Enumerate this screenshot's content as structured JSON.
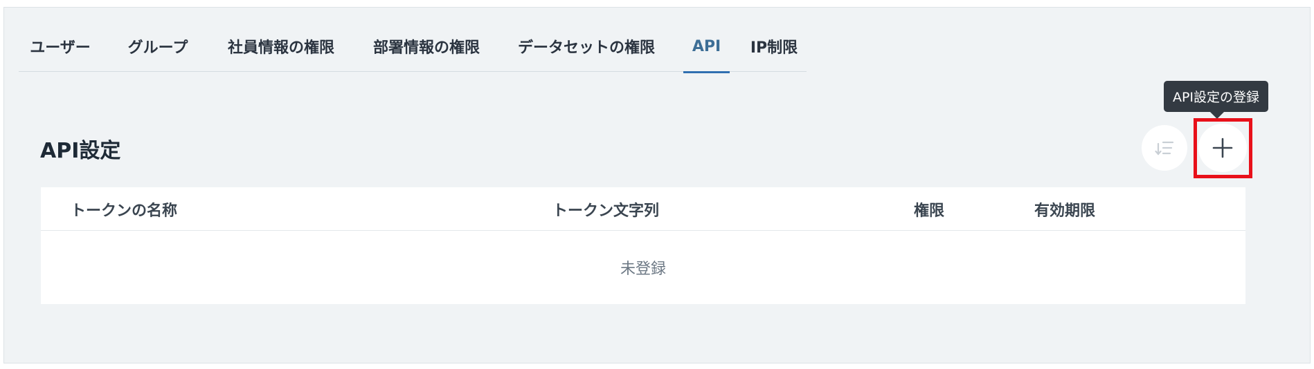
{
  "tabs": [
    {
      "label": "ユーザー"
    },
    {
      "label": "グループ"
    },
    {
      "label": "社員情報の権限"
    },
    {
      "label": "部署情報の権限"
    },
    {
      "label": "データセットの権限"
    },
    {
      "label": "API"
    },
    {
      "label": "IP制限"
    }
  ],
  "active_tab": "API",
  "section": {
    "title": "API設定",
    "add_tooltip": "API設定の登録",
    "sort_icon": "sort-icon",
    "add_icon": "plus-icon"
  },
  "table": {
    "columns": [
      "トークンの名称",
      "トークン文字列",
      "権限",
      "有効期限"
    ],
    "empty_text": "未登録"
  },
  "colors": {
    "accent": "#2f6fb0",
    "highlight": "#e8101a",
    "tooltip_bg": "#333a42",
    "panel_bg": "#f0f3f5"
  }
}
